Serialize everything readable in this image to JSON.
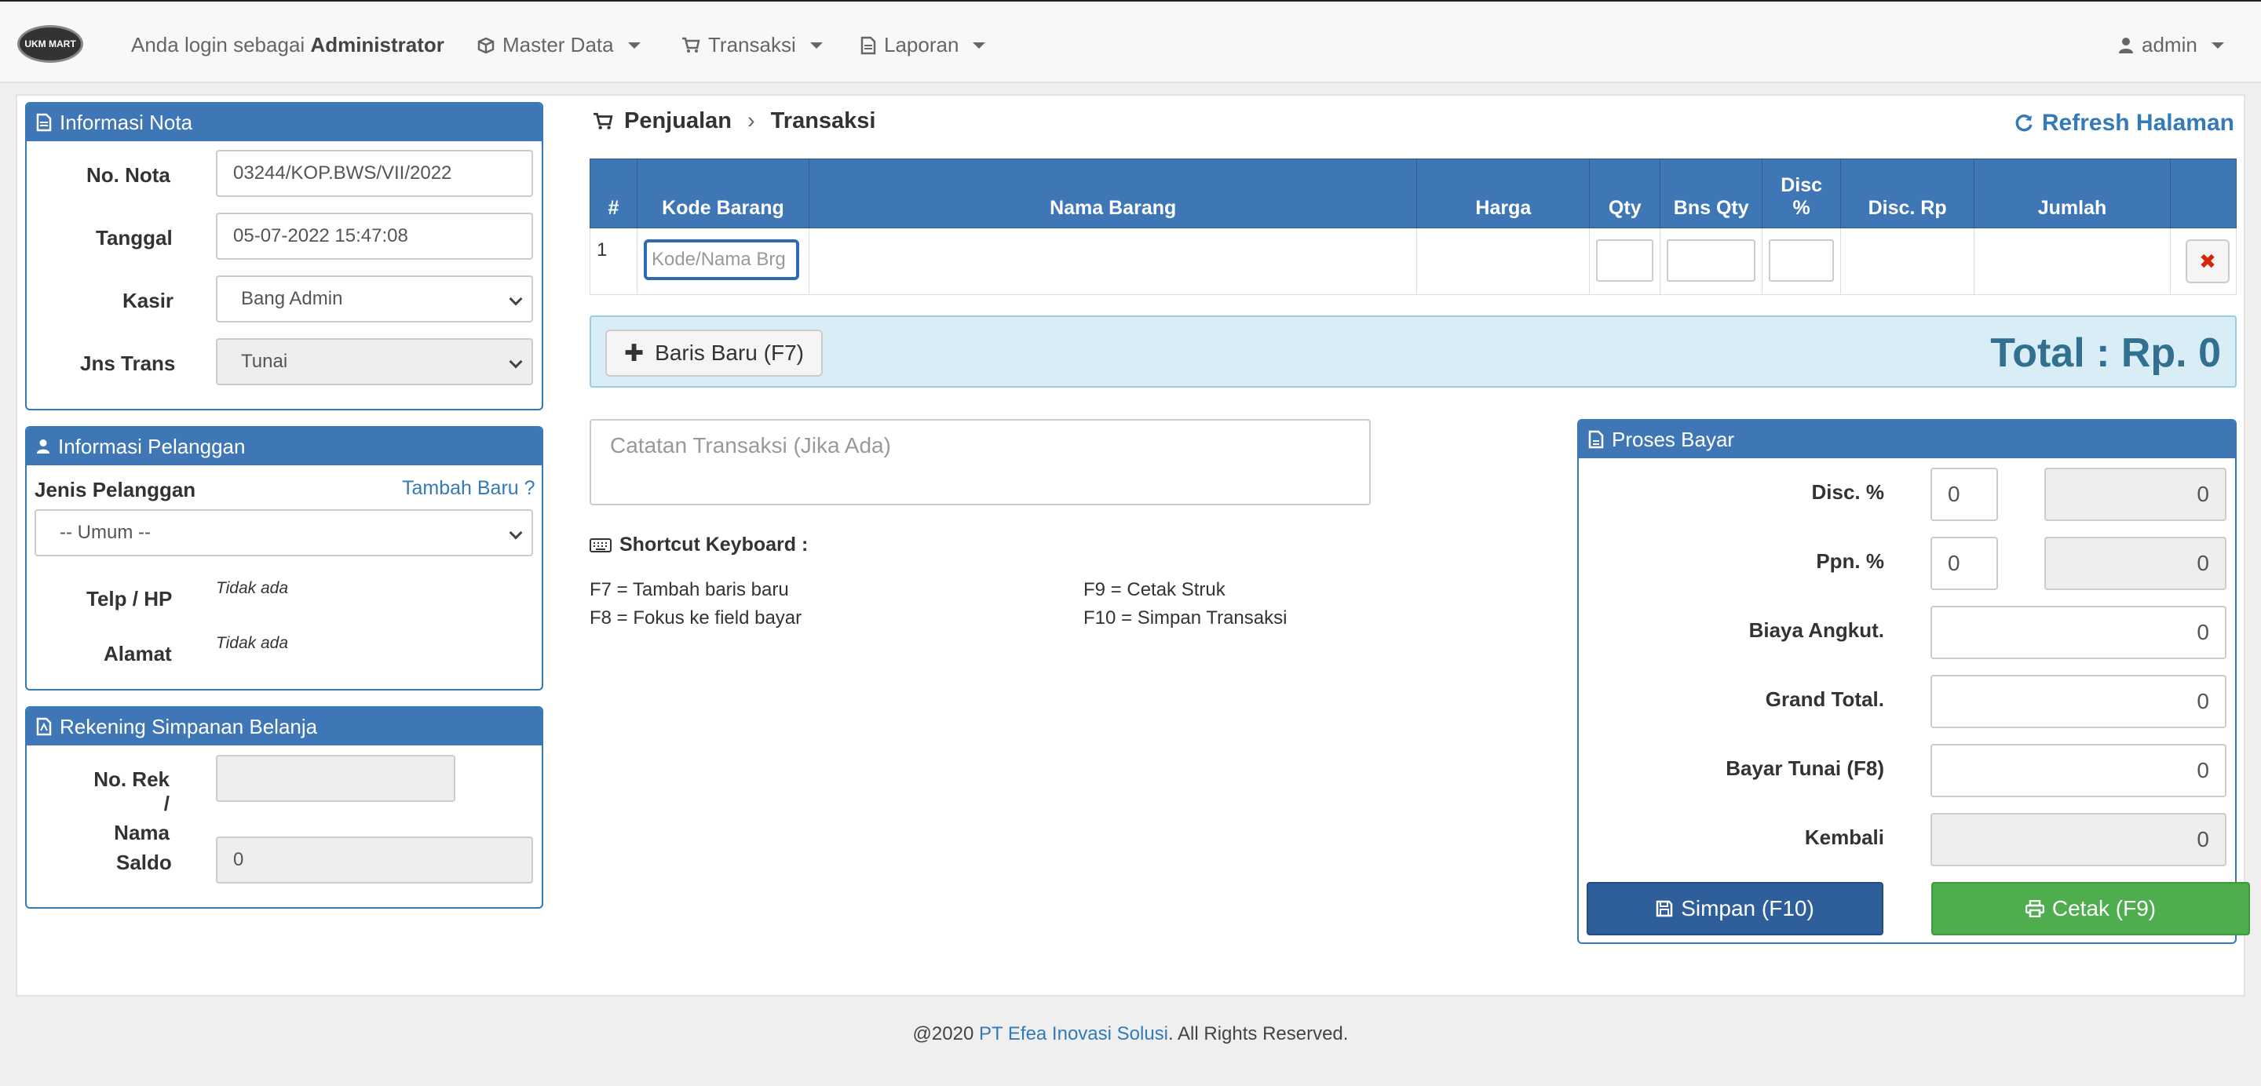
{
  "navbar": {
    "logo_text": "UKM MART",
    "login_prefix": "Anda login sebagai",
    "login_role": "Administrator",
    "menus": [
      {
        "label": "Master Data",
        "icon": "cube-icon"
      },
      {
        "label": "Transaksi",
        "icon": "cart-icon"
      },
      {
        "label": "Laporan",
        "icon": "file-icon"
      }
    ],
    "user": {
      "label": "admin",
      "icon": "user-icon"
    }
  },
  "nota": {
    "title": "Informasi Nota",
    "no_nota_label": "No. Nota",
    "no_nota": "03244/KOP.BWS/VII/2022",
    "tanggal_label": "Tanggal",
    "tanggal": "05-07-2022 15:47:08",
    "kasir_label": "Kasir",
    "kasir": "Bang Admin",
    "jns_trans_label": "Jns Trans",
    "jns_trans": "Tunai"
  },
  "pelanggan": {
    "title": "Informasi Pelanggan",
    "jenis_label": "Jenis Pelanggan",
    "tambah_baru": "Tambah Baru ?",
    "jenis_value": "-- Umum --",
    "telp_label": "Telp / HP",
    "telp_value": "Tidak ada",
    "alamat_label": "Alamat",
    "alamat_value": "Tidak ada"
  },
  "rekening": {
    "title": "Rekening Simpanan Belanja",
    "norek_label_1": "No. Rek /",
    "norek_label_2": "Nama",
    "norek_value": "",
    "saldo_label": "Saldo",
    "saldo_value": "0"
  },
  "breadcrumb": {
    "parent": "Penjualan",
    "current": "Transaksi"
  },
  "refresh_label": "Refresh Halaman",
  "table": {
    "headers": [
      "#",
      "Kode Barang",
      "Nama Barang",
      "Harga",
      "Qty",
      "Bns Qty",
      "Disc %",
      "Disc. Rp",
      "Jumlah",
      ""
    ],
    "disc_header_1": "Disc",
    "disc_header_2": "%",
    "rows": [
      {
        "no": "1",
        "kode_placeholder": "Kode/Nama Brg"
      }
    ]
  },
  "baris_baru_label": "Baris Baru (F7)",
  "total_label": "Total : Rp. 0",
  "catatan_placeholder": "Catatan Transaksi (Jika Ada)",
  "shortcut": {
    "title": "Shortcut Keyboard :",
    "f7": "F7 = Tambah baris baru",
    "f8": "F8 = Fokus ke field bayar",
    "f9": "F9 = Cetak Struk",
    "f10": "F10 = Simpan Transaksi"
  },
  "bayar": {
    "title": "Proses Bayar",
    "disc_label": "Disc. %",
    "disc_pct": "0",
    "disc_value": "0",
    "ppn_label": "Ppn. %",
    "ppn_pct": "0",
    "ppn_value": "0",
    "biaya_label": "Biaya Angkut.",
    "biaya_value": "0",
    "grand_label": "Grand Total.",
    "grand_value": "0",
    "bayar_label": "Bayar Tunai (F8)",
    "bayar_value": "0",
    "kembali_label": "Kembali",
    "kembali_value": "0",
    "simpan_label": "Simpan (F10)",
    "cetak_label": "Cetak (F9)"
  },
  "footer": {
    "prefix": "@2020",
    "company": "PT Efea Inovasi Solusi",
    "suffix": ". All Rights Reserved."
  },
  "colors": {
    "primary": "#3f77b6",
    "success": "#4eae4e",
    "info_bg": "#d9edf7",
    "total_text": "#31708f",
    "danger": "#d9230f"
  }
}
